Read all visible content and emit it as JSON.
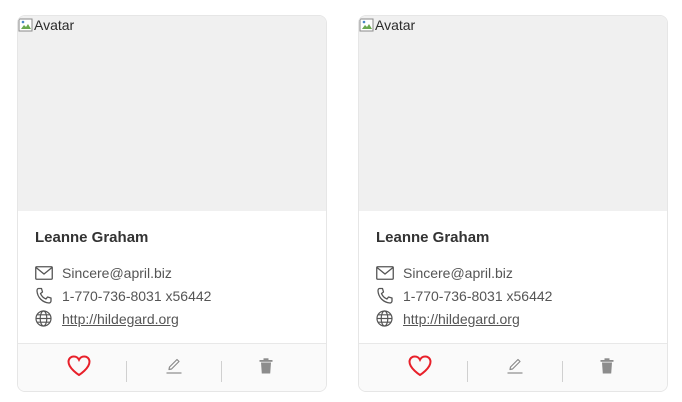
{
  "cards": [
    {
      "avatar_alt": "Avatar",
      "name": "Leanne Graham",
      "email": "Sincere@april.biz",
      "phone": "1-770-736-8031 x56442",
      "website": "http://hildegard.org",
      "liked": false
    },
    {
      "avatar_alt": "Avatar",
      "name": "Leanne Graham",
      "email": "Sincere@april.biz",
      "phone": "1-770-736-8031 x56442",
      "website": "http://hildegard.org",
      "liked": false
    }
  ],
  "icons": {
    "email": "mail-icon",
    "phone": "phone-icon",
    "website": "globe-icon",
    "like": "heart-icon",
    "edit": "edit-icon",
    "delete": "trash-icon"
  },
  "colors": {
    "heart": "#e8202a",
    "action_icon": "#8c8c8c",
    "cover": "#f0f0f0"
  }
}
